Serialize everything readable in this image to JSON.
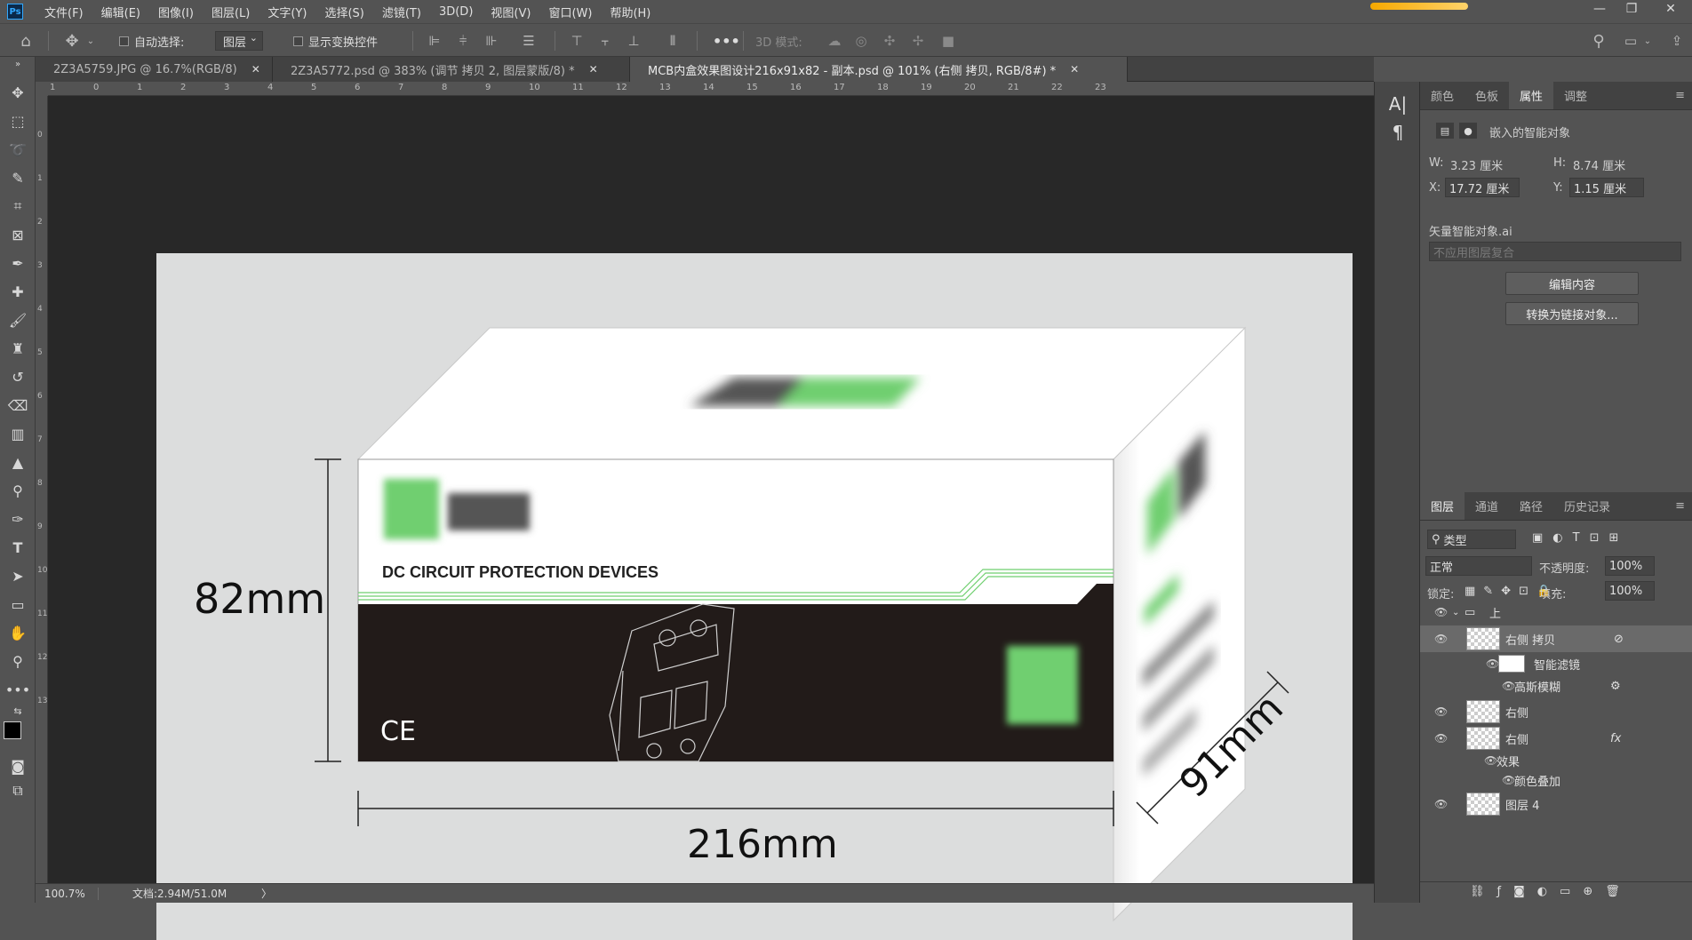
{
  "app": {
    "logo": "Ps",
    "menu": [
      "文件(F)",
      "编辑(E)",
      "图像(I)",
      "图层(L)",
      "文字(Y)",
      "选择(S)",
      "滤镜(T)",
      "3D(D)",
      "视图(V)",
      "窗口(W)",
      "帮助(H)"
    ],
    "window_buttons": [
      "—",
      "❐",
      "✕"
    ]
  },
  "options_bar": {
    "auto_select_label": "自动选择:",
    "auto_select_value": "图层",
    "show_transform_label": "显示变换控件",
    "more": "•••",
    "mode_3d_label": "3D 模式:"
  },
  "tabs": [
    {
      "label": "2Z3A5759.JPG @ 16.7%(RGB/8)",
      "close": "✕",
      "active": false
    },
    {
      "label": "2Z3A5772.psd @ 383% (调节 拷贝 2, 图层蒙版/8) *",
      "close": "✕",
      "active": false
    },
    {
      "label": "MCB内盒效果图设计216x91x82 - 副本.psd @ 101% (右侧 拷贝, RGB/8#) *",
      "close": "✕",
      "active": true
    }
  ],
  "ruler": {
    "top": [
      "1",
      "0",
      "1",
      "2",
      "3",
      "4",
      "5",
      "6",
      "7",
      "8",
      "9",
      "10",
      "11",
      "12",
      "13",
      "14",
      "15",
      "16",
      "17",
      "18",
      "19",
      "20",
      "21",
      "22",
      "23"
    ],
    "left": [
      "0",
      "1",
      "2",
      "3",
      "4",
      "5",
      "6",
      "7",
      "8",
      "9",
      "10",
      "11",
      "12",
      "13"
    ]
  },
  "artwork": {
    "box_tagline": "DC CIRCUIT PROTECTION DEVICES",
    "ce_mark": "CE",
    "dim_height": "82mm",
    "dim_width": "216mm",
    "dim_depth": "91mm",
    "colors": {
      "dark_band": "#221b19",
      "green": "#6fcf6f",
      "bg": "#dcdddd"
    }
  },
  "status": {
    "zoom": "100.7%",
    "doc_size": "文档:2.94M/51.0M",
    "arrow": "〉"
  },
  "properties": {
    "tabs": [
      "颜色",
      "色板",
      "属性",
      "调整"
    ],
    "active_tab": "属性",
    "type_label": "嵌入的智能对象",
    "w_label": "W:",
    "w_value": "3.23 厘米",
    "h_label": "H:",
    "h_value": "8.74 厘米",
    "x_label": "X:",
    "x_value": "17.72 厘米",
    "y_label": "Y:",
    "y_value": "1.15 厘米",
    "source": "矢量智能对象.ai",
    "comp_placeholder": "不应用图层复合",
    "edit_button": "编辑内容",
    "convert_button": "转换为链接对象..."
  },
  "layers": {
    "tabs": [
      "图层",
      "通道",
      "路径",
      "历史记录"
    ],
    "active_tab": "图层",
    "filter_kind": "类型",
    "blend_mode": "正常",
    "opacity_label": "不透明度:",
    "opacity_value": "100%",
    "lock_label": "锁定:",
    "fill_label": "填充:",
    "fill_value": "100%",
    "rows": [
      {
        "name": "上",
        "kind": "group"
      },
      {
        "name": "右侧 拷贝",
        "kind": "smart",
        "selected": true
      },
      {
        "name": "智能滤镜",
        "kind": "filter-mask"
      },
      {
        "name": "高斯模糊",
        "kind": "filter"
      },
      {
        "name": "右侧",
        "kind": "smart"
      },
      {
        "name": "右侧",
        "kind": "layer",
        "fx": "fx"
      },
      {
        "name": "效果",
        "kind": "effects"
      },
      {
        "name": "颜色叠加",
        "kind": "effect"
      },
      {
        "name": "图层 4",
        "kind": "layer"
      }
    ]
  }
}
